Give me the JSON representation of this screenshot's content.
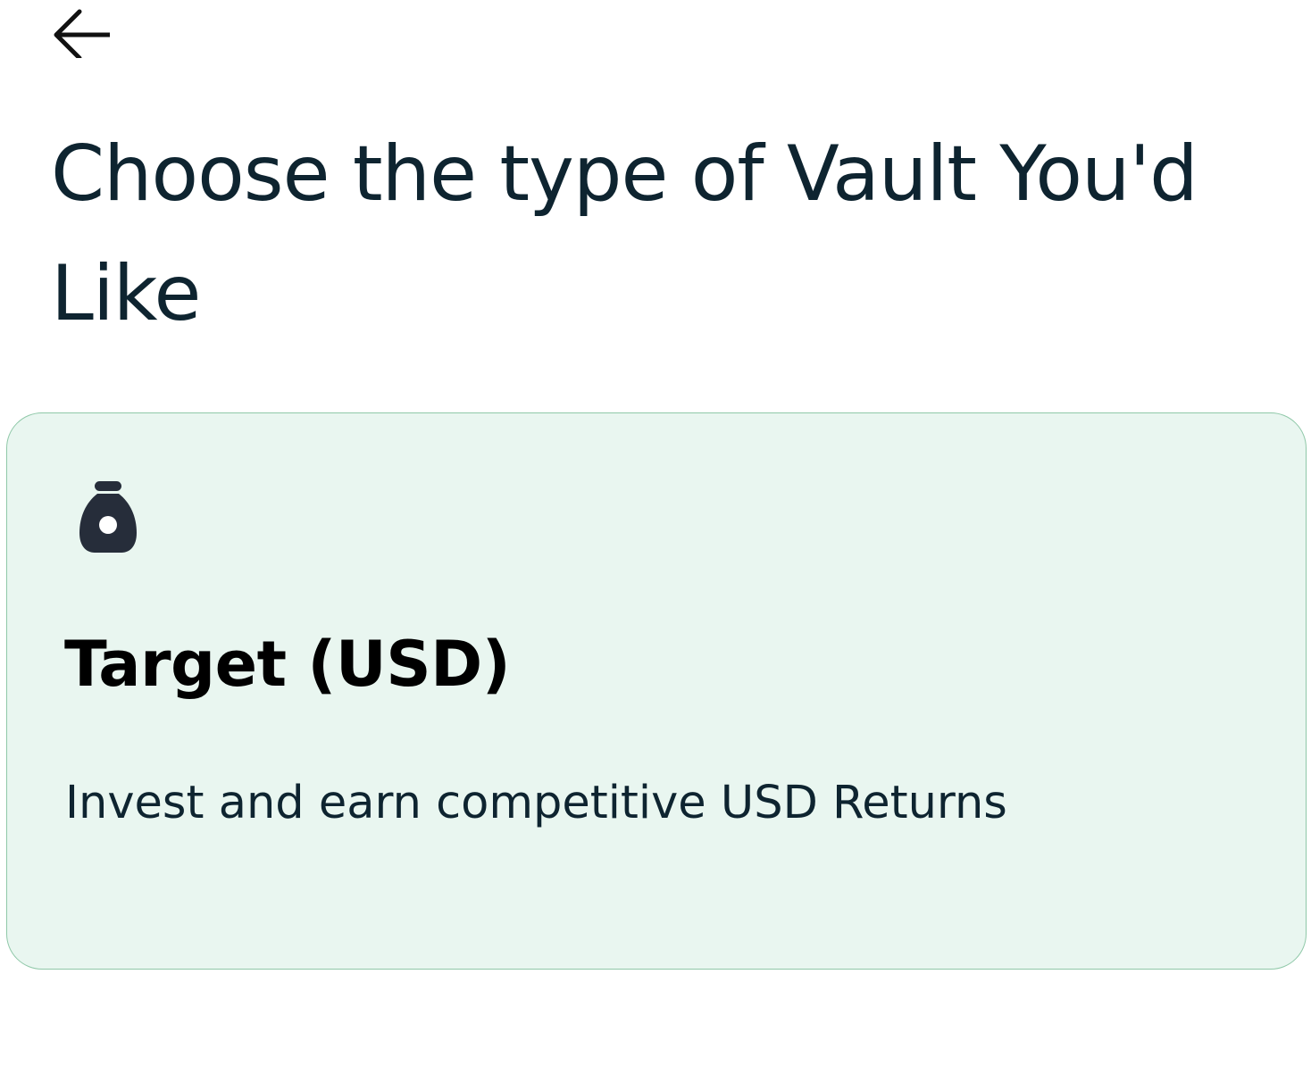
{
  "header": {
    "back_icon": "arrow-left-icon"
  },
  "page": {
    "title": "Choose the type of Vault You'd Like"
  },
  "vault_options": [
    {
      "icon": "money-bag-icon",
      "title": "Target (USD)",
      "description": "Invest and earn competitive USD Returns"
    }
  ],
  "colors": {
    "card_background": "#e9f6f0",
    "card_border": "#8fc8a8",
    "title_text": "#0e2430",
    "icon": "#262d3a"
  }
}
